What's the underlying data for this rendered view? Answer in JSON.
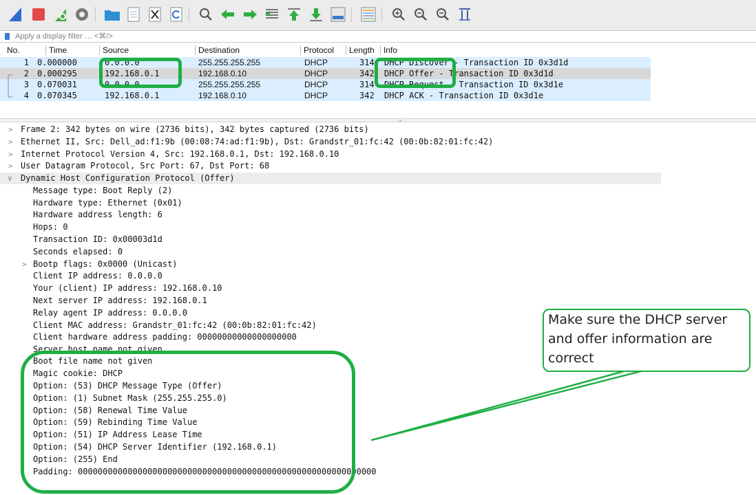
{
  "toolbar": {
    "icons": [
      "shark-fin-start-icon",
      "stop-capture-icon",
      "restart-capture-icon",
      "capture-options-icon",
      "open-file-icon",
      "save-file-icon",
      "close-file-icon",
      "reload-file-icon",
      "find-packet-icon",
      "go-back-icon",
      "go-forward-icon",
      "go-to-packet-icon",
      "first-packet-icon",
      "last-packet-icon",
      "autoscroll-icon",
      "colorize-icon",
      "zoom-in-icon",
      "zoom-out-icon",
      "normal-size-icon",
      "resize-columns-icon"
    ]
  },
  "filter": {
    "placeholder": "Apply a display filter … <⌘/>"
  },
  "columns": {
    "no": "No.",
    "time": "Time",
    "source": "Source",
    "destination": "Destination",
    "protocol": "Protocol",
    "length": "Length",
    "info": "Info"
  },
  "packets": [
    {
      "no": "1",
      "time": "0.000000",
      "source": "0.0.0.0",
      "destination": "255.255.255.255",
      "protocol": "DHCP",
      "length": "314",
      "info": "DHCP Discover - Transaction ID 0x3d1d"
    },
    {
      "no": "2",
      "time": "0.000295",
      "source": "192.168.0.1",
      "destination": "192.168.0.10",
      "protocol": "DHCP",
      "length": "342",
      "info": "DHCP Offer    - Transaction ID 0x3d1d"
    },
    {
      "no": "3",
      "time": "0.070031",
      "source": "0.0.0.0",
      "destination": "255.255.255.255",
      "protocol": "DHCP",
      "length": "314",
      "info": "DHCP Request  - Transaction ID 0x3d1e"
    },
    {
      "no": "4",
      "time": "0.070345",
      "source": "192.168.0.1",
      "destination": "192.168.0.10",
      "protocol": "DHCP",
      "length": "342",
      "info": "DHCP ACK      - Transaction ID 0x3d1e"
    }
  ],
  "details": {
    "top_level": [
      "Frame 2: 342 bytes on wire (2736 bits), 342 bytes captured (2736 bits)",
      "Ethernet II, Src: Dell_ad:f1:9b (00:08:74:ad:f1:9b), Dst: Grandstr_01:fc:42 (00:0b:82:01:fc:42)",
      "Internet Protocol Version 4, Src: 192.168.0.1, Dst: 192.168.0.10",
      "User Datagram Protocol, Src Port: 67, Dst Port: 68",
      "Dynamic Host Configuration Protocol (Offer)"
    ],
    "dhcp_fields": [
      "Message type: Boot Reply (2)",
      "Hardware type: Ethernet (0x01)",
      "Hardware address length: 6",
      "Hops: 0",
      "Transaction ID: 0x00003d1d",
      "Seconds elapsed: 0",
      "Bootp flags: 0x0000 (Unicast)",
      "Client IP address: 0.0.0.0",
      "Your (client) IP address: 192.168.0.10",
      "Next server IP address: 192.168.0.1",
      "Relay agent IP address: 0.0.0.0",
      "Client MAC address: Grandstr_01:fc:42 (00:0b:82:01:fc:42)",
      "Client hardware address padding: 00000000000000000000",
      "Server host name not given",
      "Boot file name not given",
      "Magic cookie: DHCP",
      "Option: (53) DHCP Message Type (Offer)",
      "Option: (1) Subnet Mask (255.255.255.0)",
      "Option: (58) Renewal Time Value",
      "Option: (59) Rebinding Time Value",
      "Option: (51) IP Address Lease Time",
      "Option: (54) DHCP Server Identifier (192.168.0.1)",
      "Option: (255) End",
      "Padding: 000000000000000000000000000000000000000000000000000000000000"
    ]
  },
  "callout": {
    "text": "Make sure the DHCP server and offer  information are correct"
  },
  "colors": {
    "annotation": "#1fae44",
    "row_blue": "#daeeff",
    "row_selected": "#d8d8d8"
  }
}
